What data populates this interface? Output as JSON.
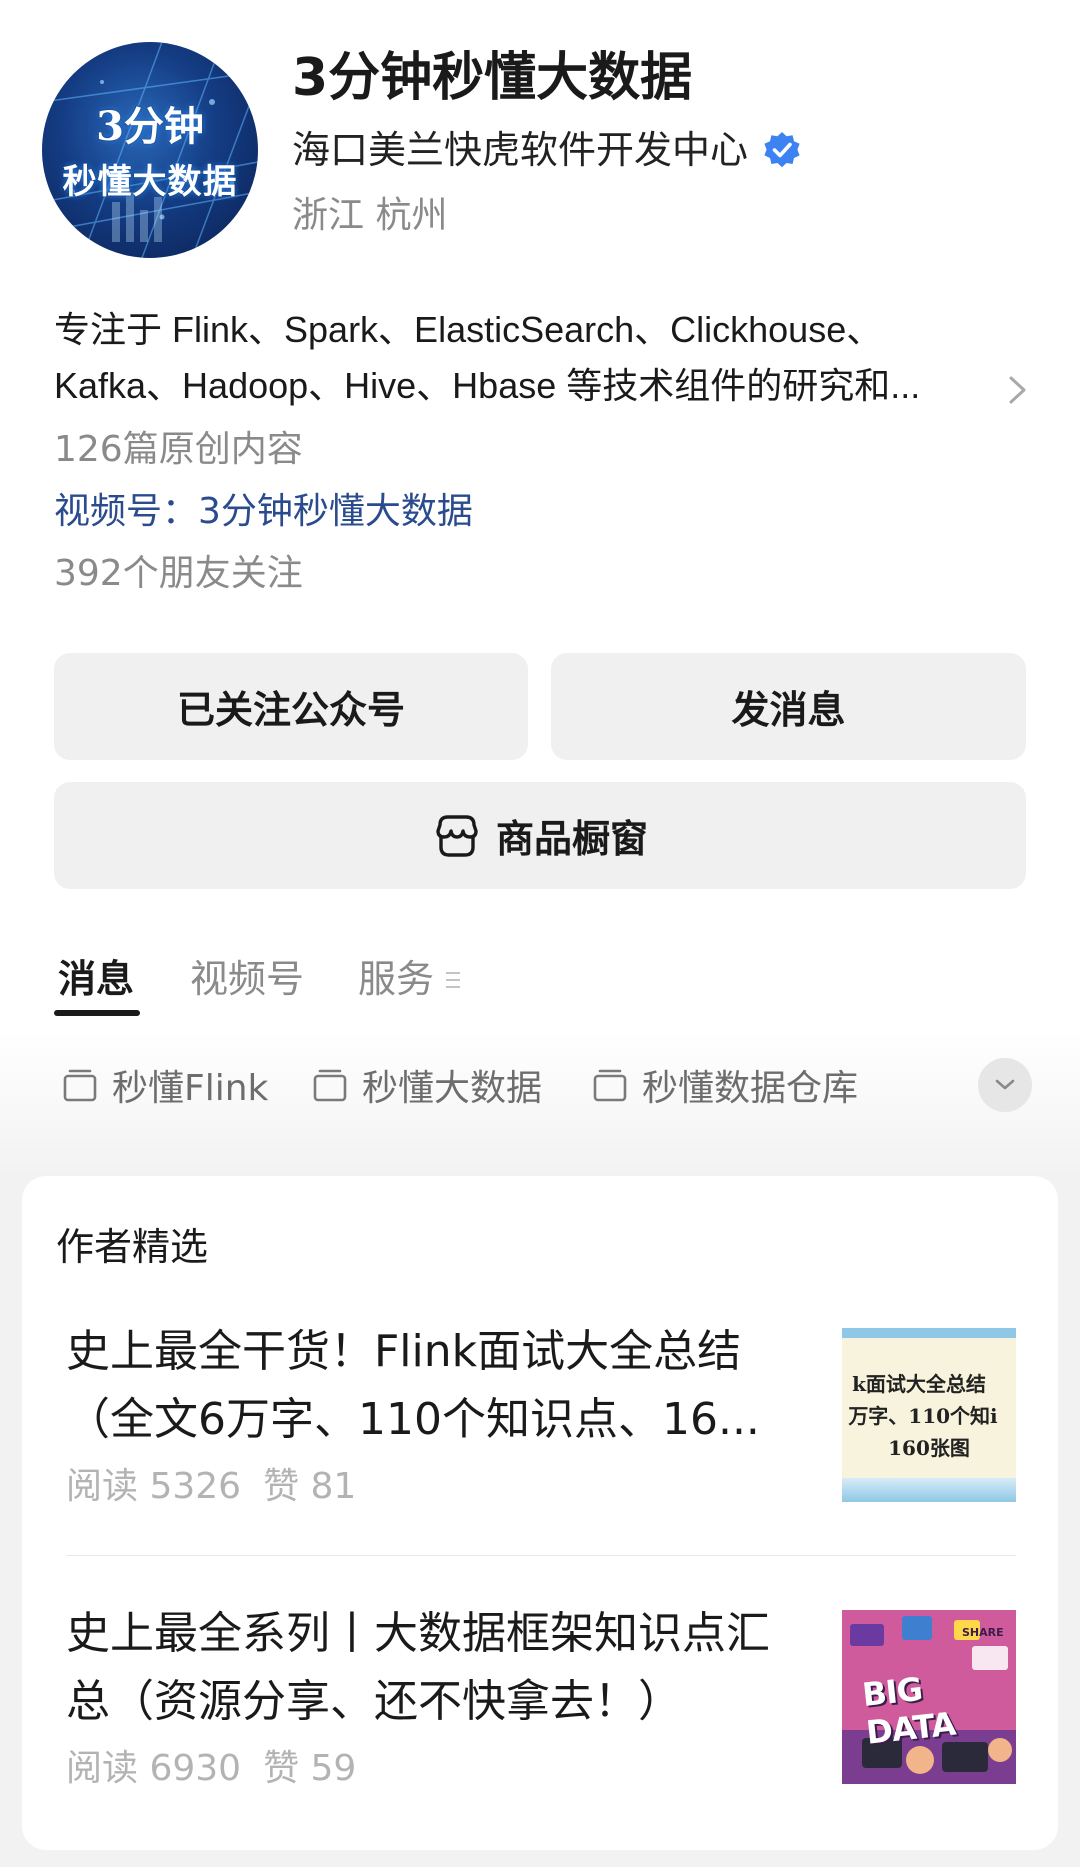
{
  "account": {
    "name": "3分钟秒懂大数据",
    "org": "海口美兰快虎软件开发中心",
    "location": "浙江  杭州",
    "avatar_line1": "3分钟",
    "avatar_line2": "秒懂大数据",
    "verified_color": "#3d82f2"
  },
  "bio": {
    "line1": "专注于 Flink、Spark、ElasticSearch、Clickhouse、",
    "line2": "Kafka、Hadoop、Hive、Hbase 等技术组件的研究和..."
  },
  "stats": {
    "articles": "126篇原创内容",
    "channel": "视频号：3分钟秒懂大数据",
    "friends": "392个朋友关注"
  },
  "buttons": {
    "follow": "已关注公众号",
    "message": "发消息",
    "shop": "商品橱窗"
  },
  "tabs": [
    {
      "label": "消息",
      "active": true
    },
    {
      "label": "视频号",
      "active": false
    },
    {
      "label": "服务",
      "active": false
    }
  ],
  "collections": [
    "秒懂Flink",
    "秒懂大数据",
    "秒懂数据仓库"
  ],
  "featured": {
    "title": "作者精选",
    "articles": [
      {
        "title_line1": "史上最全干货！Flink面试大全总结",
        "title_line2": "（全文6万字、110个知识点、16...",
        "reads": "阅读 5326",
        "likes": "赞 81",
        "thumb_lines": [
          "k面试大全总结",
          "万字、110个知i",
          "160张图"
        ]
      },
      {
        "title_line1": "史上最全系列丨大数据框架知识点汇",
        "title_line2": "总（资源分享、还不快拿去！）",
        "reads": "阅读 6930",
        "likes": "赞 59",
        "thumb_lines": [
          "BIG DATA",
          "SHARE"
        ]
      }
    ]
  },
  "colors": {
    "link": "#2a4b8d",
    "muted": "#8a8a8a",
    "button_bg": "#f0f0f0"
  }
}
